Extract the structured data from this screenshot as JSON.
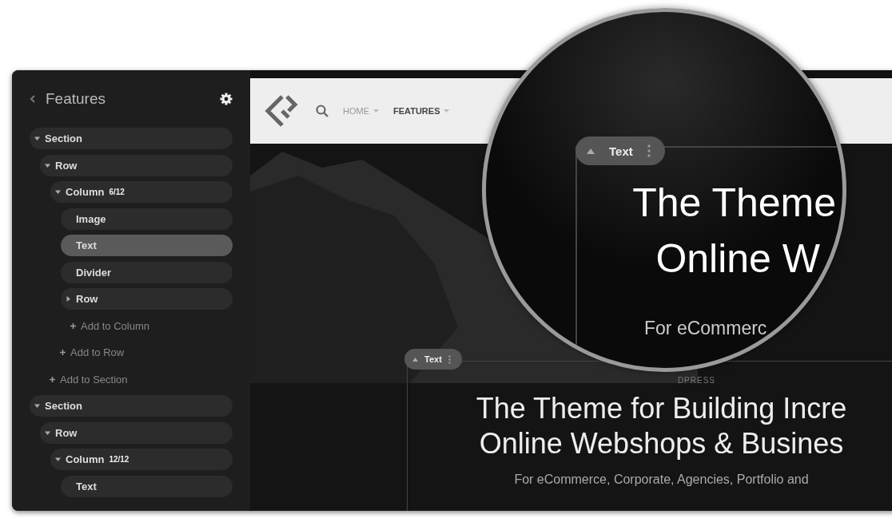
{
  "sidebar": {
    "title": "Features",
    "tree": [
      {
        "label": "Section",
        "kind": "element",
        "selected": false,
        "expanded": true,
        "children": [
          {
            "label": "Row",
            "kind": "element",
            "selected": false,
            "expanded": true,
            "children": [
              {
                "label": "Column",
                "badge": "6/12",
                "kind": "element",
                "selected": false,
                "expanded": true,
                "children": [
                  {
                    "label": "Image",
                    "kind": "element",
                    "selected": false
                  },
                  {
                    "label": "Text",
                    "kind": "element",
                    "selected": true
                  },
                  {
                    "label": "Divider",
                    "kind": "element",
                    "selected": false
                  },
                  {
                    "label": "Row",
                    "kind": "element",
                    "selected": false,
                    "expanded": false
                  },
                  {
                    "label": "Add to Column",
                    "kind": "add"
                  }
                ]
              },
              {
                "label": "Add to Row",
                "kind": "add"
              }
            ]
          },
          {
            "label": "Add to Section",
            "kind": "add"
          }
        ]
      },
      {
        "label": "Section",
        "kind": "element",
        "selected": false,
        "expanded": true,
        "children": [
          {
            "label": "Row",
            "kind": "element",
            "selected": false,
            "expanded": true,
            "children": [
              {
                "label": "Column",
                "badge": "12/12",
                "kind": "element",
                "selected": false,
                "expanded": true,
                "children": [
                  {
                    "label": "Text",
                    "kind": "element",
                    "selected": false
                  }
                ]
              }
            ]
          }
        ]
      }
    ]
  },
  "header": {
    "nav": [
      {
        "label": "HOME",
        "selected": false
      },
      {
        "label": "FEATURES",
        "selected": true
      }
    ]
  },
  "canvas": {
    "element_tag": "Text",
    "eyebrow": "DPRESS",
    "heading_lines": [
      "The Theme for Building Incre",
      "Online Webshops & Busines"
    ],
    "subtitle": "For eCommerce, Corporate, Agencies, Portfolio and"
  },
  "magnifier": {
    "element_tag": "Text",
    "heading_lines": [
      "The Theme",
      "Online W"
    ],
    "subtitle": "For eCommerc"
  }
}
